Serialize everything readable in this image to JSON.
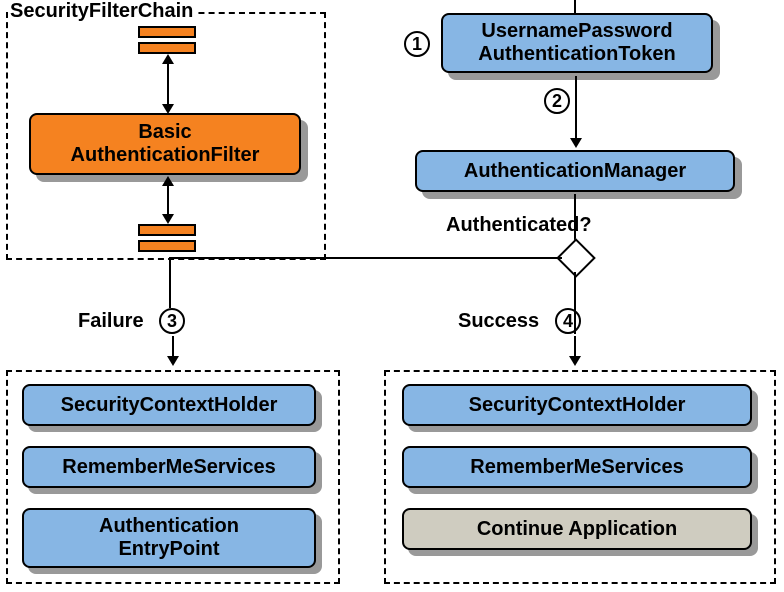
{
  "left": {
    "chainLabel": "SecurityFilterChain",
    "filter": {
      "line1": "Basic",
      "line2": "AuthenticationFilter"
    },
    "failureLabel": "Failure",
    "failureItems": {
      "i1": "SecurityContextHolder",
      "i2": "RememberMeServices",
      "i3a": "Authentication",
      "i3b": "EntryPoint"
    }
  },
  "right": {
    "token": {
      "line1": "UsernamePassword",
      "line2": "AuthenticationToken"
    },
    "manager": "AuthenticationManager",
    "authLabel": "Authenticated?",
    "successLabel": "Success",
    "successItems": {
      "i1": "SecurityContextHolder",
      "i2": "RememberMeServices",
      "i3": "Continue Application"
    }
  },
  "steps": {
    "s1": "1",
    "s2": "2",
    "s3": "3",
    "s4": "4"
  }
}
